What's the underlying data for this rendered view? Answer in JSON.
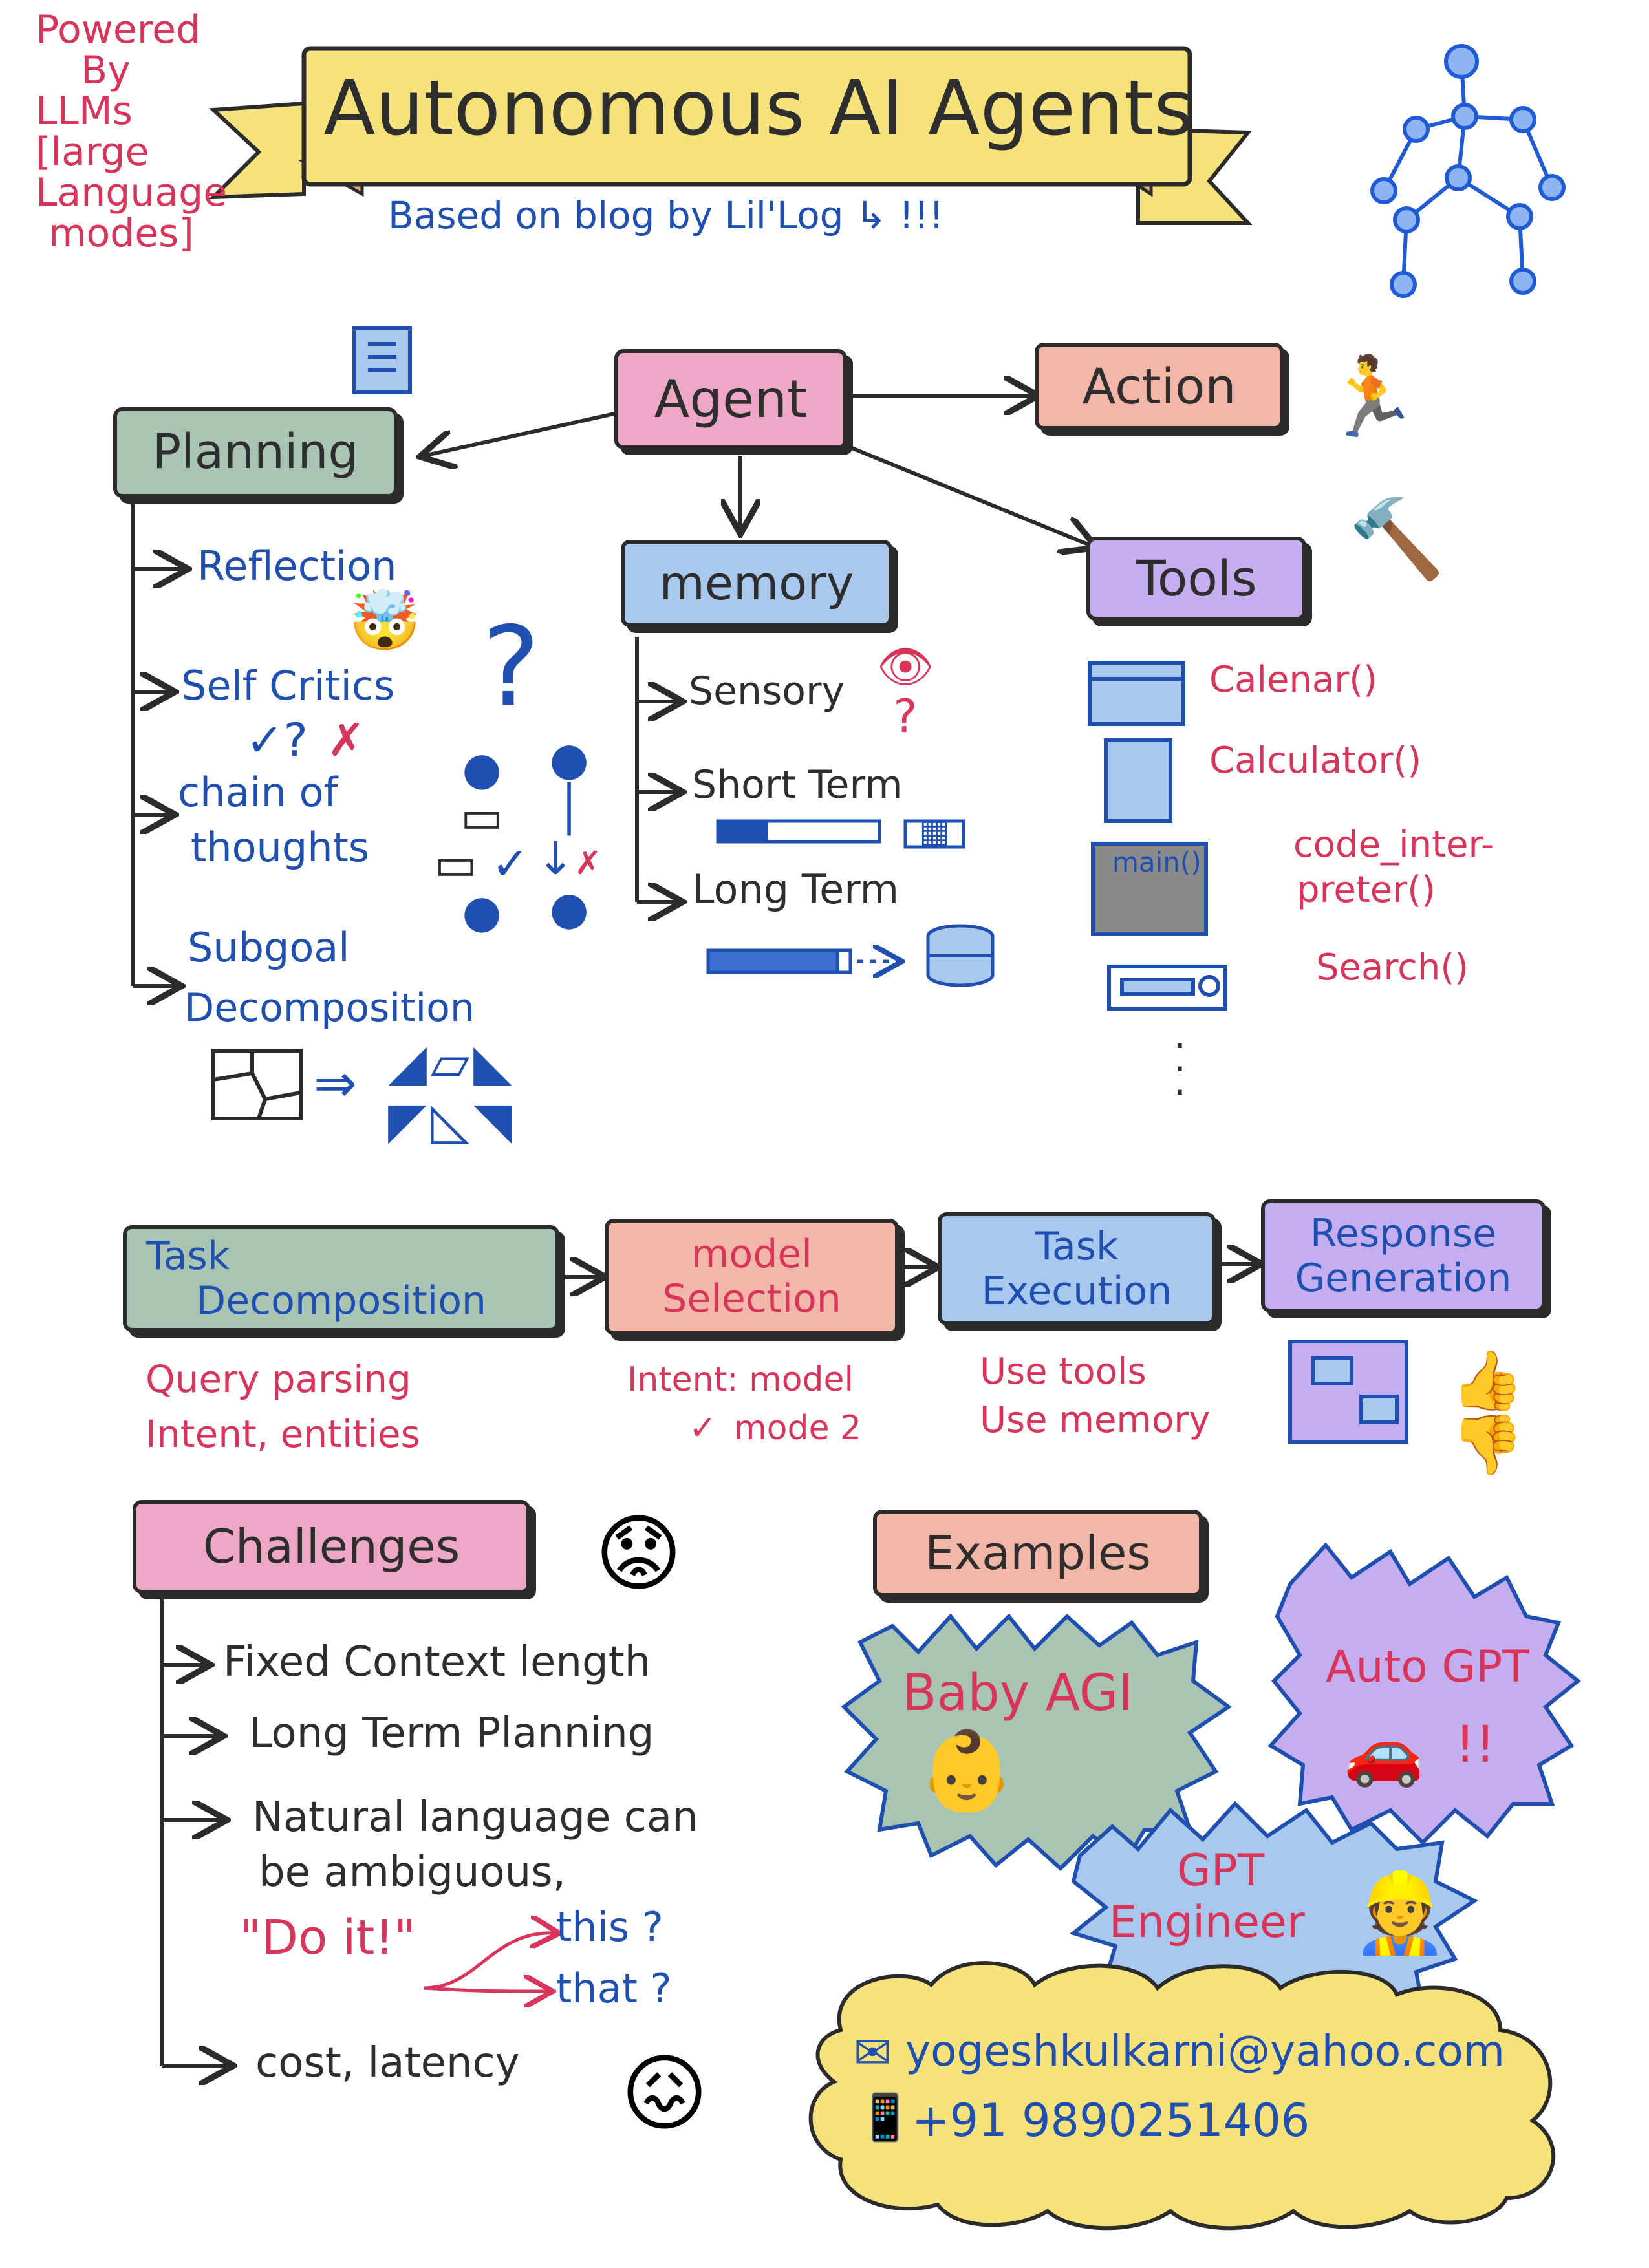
{
  "header": {
    "powered_by": [
      "Powered",
      "By",
      "LLMs",
      "[large",
      "Language",
      "modes]"
    ],
    "title": "Autonomous AI Agents",
    "subtitle": "Based on blog by Lil'Log ↳ !!!"
  },
  "agent": {
    "center_label": "Agent",
    "action_label": "Action",
    "planning": {
      "label": "Planning",
      "items": [
        "Reflection",
        "Self Critics",
        "chain of",
        "thoughts",
        "Subgoal",
        "Decomposition"
      ]
    },
    "memory": {
      "label": "memory",
      "items": [
        "Sensory",
        "Short Term",
        "Long Term"
      ]
    },
    "tools": {
      "label": "Tools",
      "items": [
        "Calenar()",
        "Calculator()",
        "code_inter-",
        "preter()",
        "Search()"
      ],
      "code_icon_text": "main()"
    }
  },
  "pipeline": {
    "steps": [
      {
        "label_lines": [
          "Task",
          "Decomposition"
        ],
        "notes": [
          "Query parsing",
          "Intent, entities"
        ]
      },
      {
        "label_lines": [
          "model",
          "Selection"
        ],
        "notes": [
          "Intent: model",
          "mode 2"
        ]
      },
      {
        "label_lines": [
          "Task",
          "Execution"
        ],
        "notes": [
          "Use tools",
          "Use memory"
        ]
      },
      {
        "label_lines": [
          "Response",
          "Generation"
        ],
        "notes": []
      }
    ]
  },
  "challenges": {
    "label": "Challenges",
    "items": [
      "Fixed Context length",
      "Long Term Planning",
      "Natural language can",
      "be ambiguous,",
      "cost, latency"
    ],
    "example_quote": "\"Do it!\"",
    "example_branches": [
      "this ?",
      "that ?"
    ]
  },
  "examples": {
    "label": "Examples",
    "items": [
      "Baby AGI",
      "Auto GPT",
      "GPT",
      "Engineer"
    ],
    "exclaim": "!!"
  },
  "contact": {
    "email": "yogeshkulkarni@yahoo.com",
    "phone": "+91 9890251406"
  },
  "colors": {
    "ink": "#2b2b2b",
    "blue_ink": "#1f4fb0",
    "red_ink": "#d9345a",
    "yellow": "#f6e27a",
    "pink": "#eea7c6",
    "green_gray": "#a9c4b2",
    "blue_fill": "#a9c8ee",
    "purple_fill": "#c5aef0",
    "salmon_fill": "#f2b7a8"
  }
}
